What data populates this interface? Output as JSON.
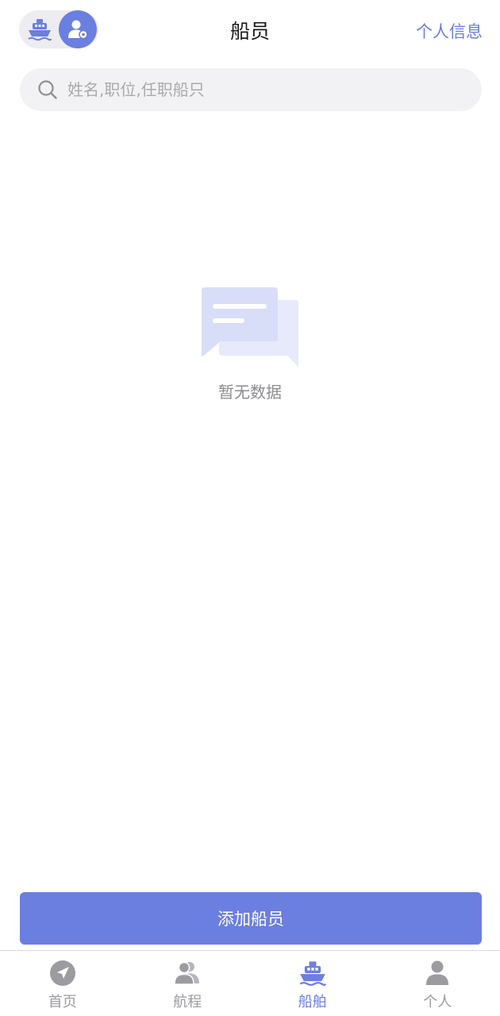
{
  "header": {
    "title": "船员",
    "right_link": "个人信息",
    "toggle": {
      "options": [
        "ship-icon",
        "crew-manager-icon"
      ],
      "active_option": "crew-manager-icon"
    }
  },
  "search": {
    "placeholder": "姓名,职位,任职船只",
    "value": "",
    "icon": "search-icon"
  },
  "empty_state": {
    "icon": "chat-bubbles-icon",
    "text": "暂无数据"
  },
  "primary_action": {
    "label": "添加船员"
  },
  "tabbar": {
    "items": [
      {
        "label": "首页",
        "icon": "navigation-icon",
        "active": false
      },
      {
        "label": "航程",
        "icon": "users-icon",
        "active": false
      },
      {
        "label": "船舶",
        "icon": "ship-icon",
        "active": true
      },
      {
        "label": "个人",
        "icon": "person-icon",
        "active": false
      }
    ]
  },
  "colors": {
    "accent": "#6a7fdf",
    "tab_inactive": "#9b9ba0",
    "search_bg": "#f2f2f4",
    "toggle_bg": "#ececf1",
    "empty_icon_front": "#d8def8",
    "empty_icon_back": "#e6eafb"
  }
}
